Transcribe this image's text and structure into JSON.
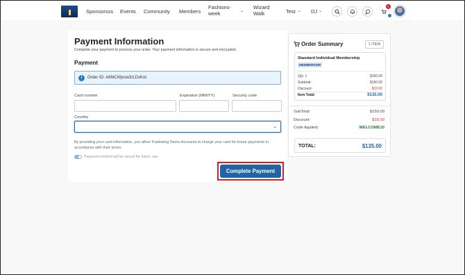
{
  "nav": {
    "items": [
      "Sponsorsss",
      "Events",
      "Community",
      "Members"
    ],
    "fashions": [
      "Fashions-",
      "week"
    ],
    "wizard": [
      "Wizard",
      "Walk"
    ],
    "test": "Test",
    "dj": "DJ",
    "notif_count": "1"
  },
  "payment": {
    "title": "Payment Information",
    "subtitle": "Complete your payment to process your order. Your payment information is secure and encrypted.",
    "section": "Payment",
    "order_id": "Order ID: A6MCWjvsw3rLDvKot",
    "card_number_label": "Card number",
    "expiration_label": "Expiration (MM/YY)",
    "security_label": "Security code",
    "country_label": "Country",
    "consent": "By providing your card information, you allow Tradewing Demo Accounts to charge your card for future payments in accordance with their terms.",
    "save_label": "Payment method will be saved for future use",
    "button": "Complete Payment"
  },
  "summary": {
    "title": "Order Summary",
    "item_count": "1 ITEM",
    "product": "Standard Individual Membership",
    "tag": "MEMBERSHIP",
    "qty_label": "Qty: 1",
    "qty_value": "$150.00",
    "subtotal_label": "Subtotal:",
    "subtotal_value": "$150.00",
    "discount_label": "Discount:",
    "discount_value": "-$15.00",
    "item_total_label": "Item Total:",
    "item_total_value": "$135.00",
    "outer_subtotal_label": "SubTotal:",
    "outer_subtotal_value": "$150.00",
    "outer_discount_label": "Discount:",
    "outer_discount_value": "$15.00",
    "code_label": "Code Applied:",
    "code_value": "WELCOME10",
    "total_label": "TOTAL:",
    "total_value": "$135.00"
  },
  "colors": {
    "accent": "#1f64a6",
    "highlight": "#e01b24",
    "discount": "#d6312a",
    "code": "#1a7a2e"
  },
  "icons": [
    "search-icon",
    "bell-icon",
    "chat-icon",
    "cart-icon",
    "info-icon",
    "chevron-down-icon"
  ]
}
